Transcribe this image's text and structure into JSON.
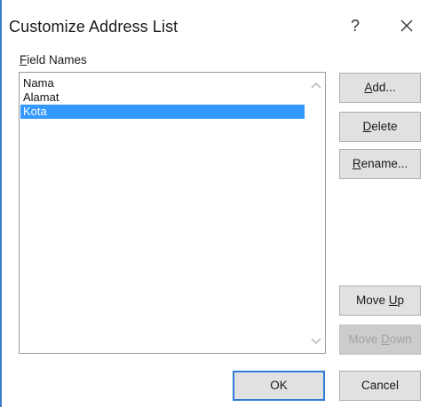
{
  "window": {
    "title": "Customize Address List",
    "help_glyph": "?"
  },
  "fields": {
    "label_accel": "F",
    "label_rest": "ield Names",
    "items": [
      {
        "label": "Nama",
        "selected": false
      },
      {
        "label": "Alamat",
        "selected": false
      },
      {
        "label": "Kota",
        "selected": true
      }
    ]
  },
  "buttons": {
    "add": {
      "accel": "A",
      "rest": "dd..."
    },
    "delete": {
      "accel": "D",
      "rest": "elete"
    },
    "rename": {
      "accel": "R",
      "rest": "ename..."
    },
    "move_up": {
      "pre": "Move ",
      "accel": "U",
      "rest": "p"
    },
    "move_down": {
      "pre": "Move ",
      "accel": "D",
      "rest": "own",
      "disabled": true
    },
    "ok": "OK",
    "cancel": "Cancel"
  },
  "colors": {
    "selection": "#3399ff",
    "focus_border": "#2f7bd6",
    "window_border": "#3d7cc2"
  }
}
